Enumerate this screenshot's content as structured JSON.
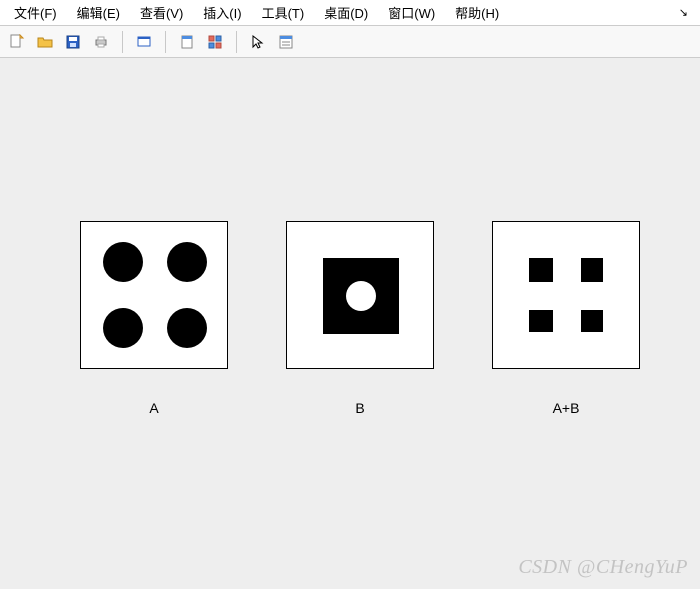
{
  "menu": {
    "file": "文件(F)",
    "edit": "编辑(E)",
    "view": "查看(V)",
    "insert": "插入(I)",
    "tool": "工具(T)",
    "desktop": "桌面(D)",
    "window": "窗口(W)",
    "help": "帮助(H)"
  },
  "panels": {
    "a": "A",
    "b": "B",
    "c": "A+B"
  },
  "watermark": "CSDN @CHengYuP"
}
